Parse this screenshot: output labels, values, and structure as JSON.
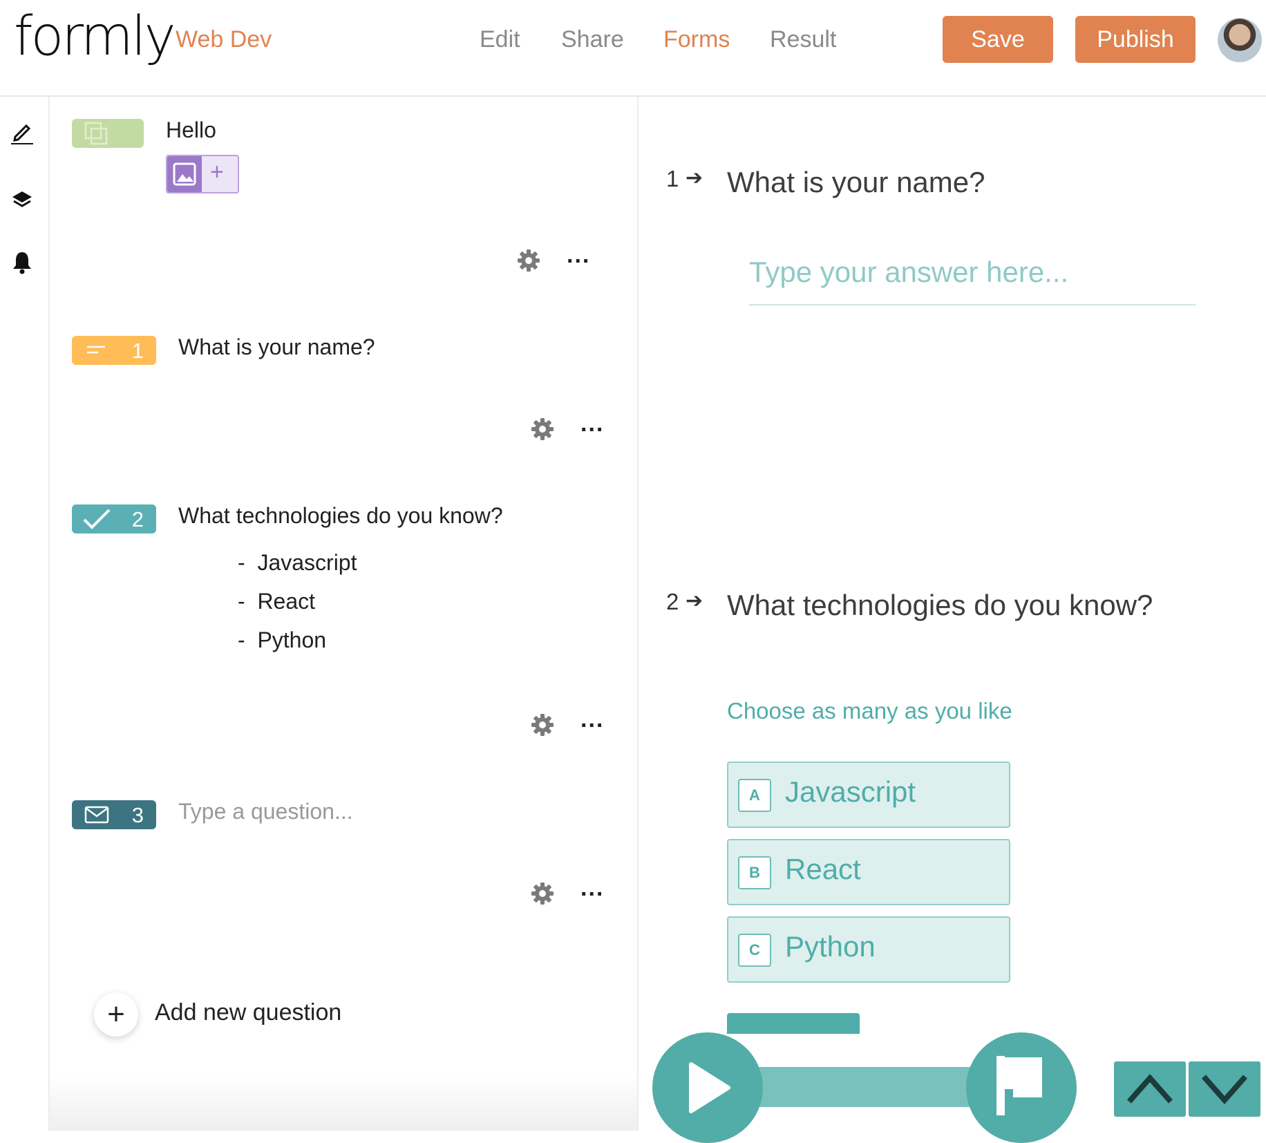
{
  "header": {
    "logo": "formly",
    "project": "Web Dev",
    "nav": [
      "Edit",
      "Share",
      "Forms",
      "Result"
    ],
    "active_nav": "Forms",
    "save_label": "Save",
    "publish_label": "Publish"
  },
  "colors": {
    "accent": "#e08350",
    "teal": "#52aca8",
    "welcome_badge": "#c2dba3",
    "text_badge": "#ffbc57",
    "multi_badge": "#5ab0b5",
    "email_badge": "#3d7481",
    "image_block": "#9b79c8"
  },
  "editor": {
    "welcome": {
      "title": "Hello"
    },
    "questions": [
      {
        "number": "1",
        "icon": "short-text-icon",
        "title": "What is your name?"
      },
      {
        "number": "2",
        "icon": "checkmark-icon",
        "title": "What technologies do you know?",
        "options": [
          "Javascript",
          "React",
          "Python"
        ]
      },
      {
        "number": "3",
        "icon": "mail-icon",
        "placeholder": "Type a question..."
      }
    ],
    "option_dash": "-",
    "add_question": "Add new question",
    "dots": "..."
  },
  "preview": {
    "q1": {
      "number": "1",
      "title": "What is your name?",
      "placeholder": "Type your answer here..."
    },
    "q2": {
      "number": "2",
      "title": "What technologies do you know?",
      "hint": "Choose as many as you like",
      "choices": [
        {
          "key": "A",
          "label": "Javascript"
        },
        {
          "key": "B",
          "label": "React"
        },
        {
          "key": "C",
          "label": "Python"
        }
      ]
    },
    "arrow": "➔"
  }
}
